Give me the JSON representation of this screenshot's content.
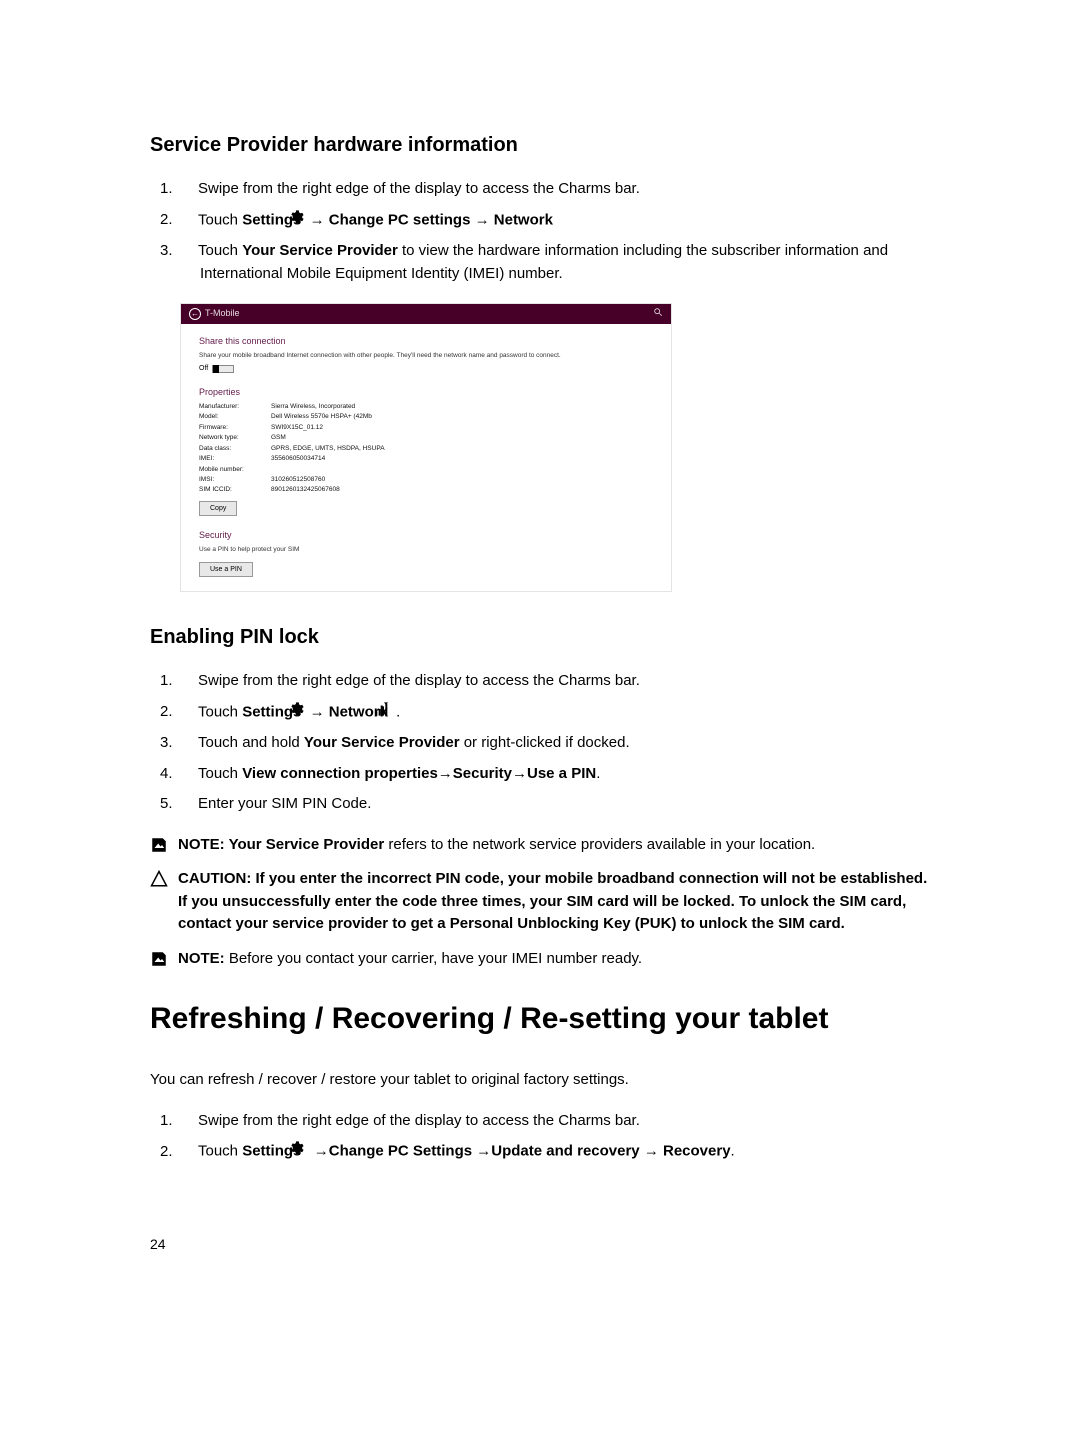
{
  "section1": {
    "heading": "Service Provider hardware information",
    "steps_prefix": [
      "1.",
      "2.",
      "3."
    ],
    "step1": "Swipe from the right edge of the display to access the Charms bar.",
    "step2_a": "Touch ",
    "step2_settings": "Settings",
    "step2_arrow1": "→ ",
    "step2_change": "Change PC settings",
    "step2_arrow2": " → ",
    "step2_network": "Network",
    "step3_a": "Touch ",
    "step3_provider": "Your Service Provider",
    "step3_b": " to view the hardware information including the subscriber information and International Mobile Equipment Identity (IMEI) number."
  },
  "screenshot": {
    "title": "T-Mobile",
    "share_heading": "Share this connection",
    "share_desc": "Share your mobile broadband Internet connection with other people. They'll need the network name and password to connect.",
    "toggle_label": "Off",
    "props_heading": "Properties",
    "rows": [
      {
        "k": "Manufacturer:",
        "v": "Sierra Wireless, Incorporated"
      },
      {
        "k": "Model:",
        "v": "Dell Wireless 5570e HSPA+ (42Mb"
      },
      {
        "k": "Firmware:",
        "v": "SWI9X15C_01.12"
      },
      {
        "k": "Network type:",
        "v": "GSM"
      },
      {
        "k": "Data class:",
        "v": "GPRS, EDGE, UMTS, HSDPA, HSUPA"
      },
      {
        "k": "IMEI:",
        "v": "355606050034714"
      },
      {
        "k": "Mobile number:",
        "v": ""
      },
      {
        "k": "IMSI:",
        "v": "310260512508760"
      },
      {
        "k": "SIM ICCID:",
        "v": "8901260132425067608"
      }
    ],
    "copy_btn": "Copy",
    "security_heading": "Security",
    "security_desc": "Use a PIN to help protect your SIM",
    "usepin_btn": "Use a PIN"
  },
  "section2": {
    "heading": "Enabling PIN lock",
    "steps_prefix": [
      "1.",
      "2.",
      "3.",
      "4.",
      "5."
    ],
    "step1": "Swipe from the right edge of the display to access the Charms bar.",
    "step2_a": "Touch ",
    "step2_settings": "Settings",
    "step2_arrow": "→ ",
    "step2_network": "Network",
    "step2_period": ".",
    "step3_a": "Touch and hold ",
    "step3_provider": "Your Service Provider",
    "step3_b": " or right-clicked if docked.",
    "step4_a": "Touch ",
    "step4_b": "View connection properties→Security→Use a PIN",
    "step4_c": ".",
    "step5": "Enter your SIM PIN Code."
  },
  "notes": {
    "note1_label": "NOTE: ",
    "note1_provider": "Your Service Provider",
    "note1_text": " refers to the network service providers available in your location.",
    "caution_label": "CAUTION: If you enter the incorrect PIN code, your mobile broadband connection will not be established. If you unsuccessfully enter the code three times, your SIM card will be locked. To unlock the SIM card, contact your service provider to get a Personal Unblocking Key (PUK) to unlock the SIM card.",
    "note2_label": "NOTE:",
    "note2_text": " Before you contact your carrier, have your IMEI number ready."
  },
  "section3": {
    "heading": "Refreshing / Recovering / Re-setting your tablet",
    "intro": "You can refresh / recover / restore your tablet to original factory settings.",
    "steps_prefix": [
      "1.",
      "2."
    ],
    "step1": "Swipe from the right edge of the display to access the Charms bar.",
    "step2_a": "Touch ",
    "step2_settings": "Settings",
    "step2_b": " →",
    "step2_change": "Change PC Settings",
    "step2_c": " →",
    "step2_update": "Update and recovery",
    "step2_d": " → ",
    "step2_recovery": "Recovery",
    "step2_e": "."
  },
  "page_number": "24"
}
